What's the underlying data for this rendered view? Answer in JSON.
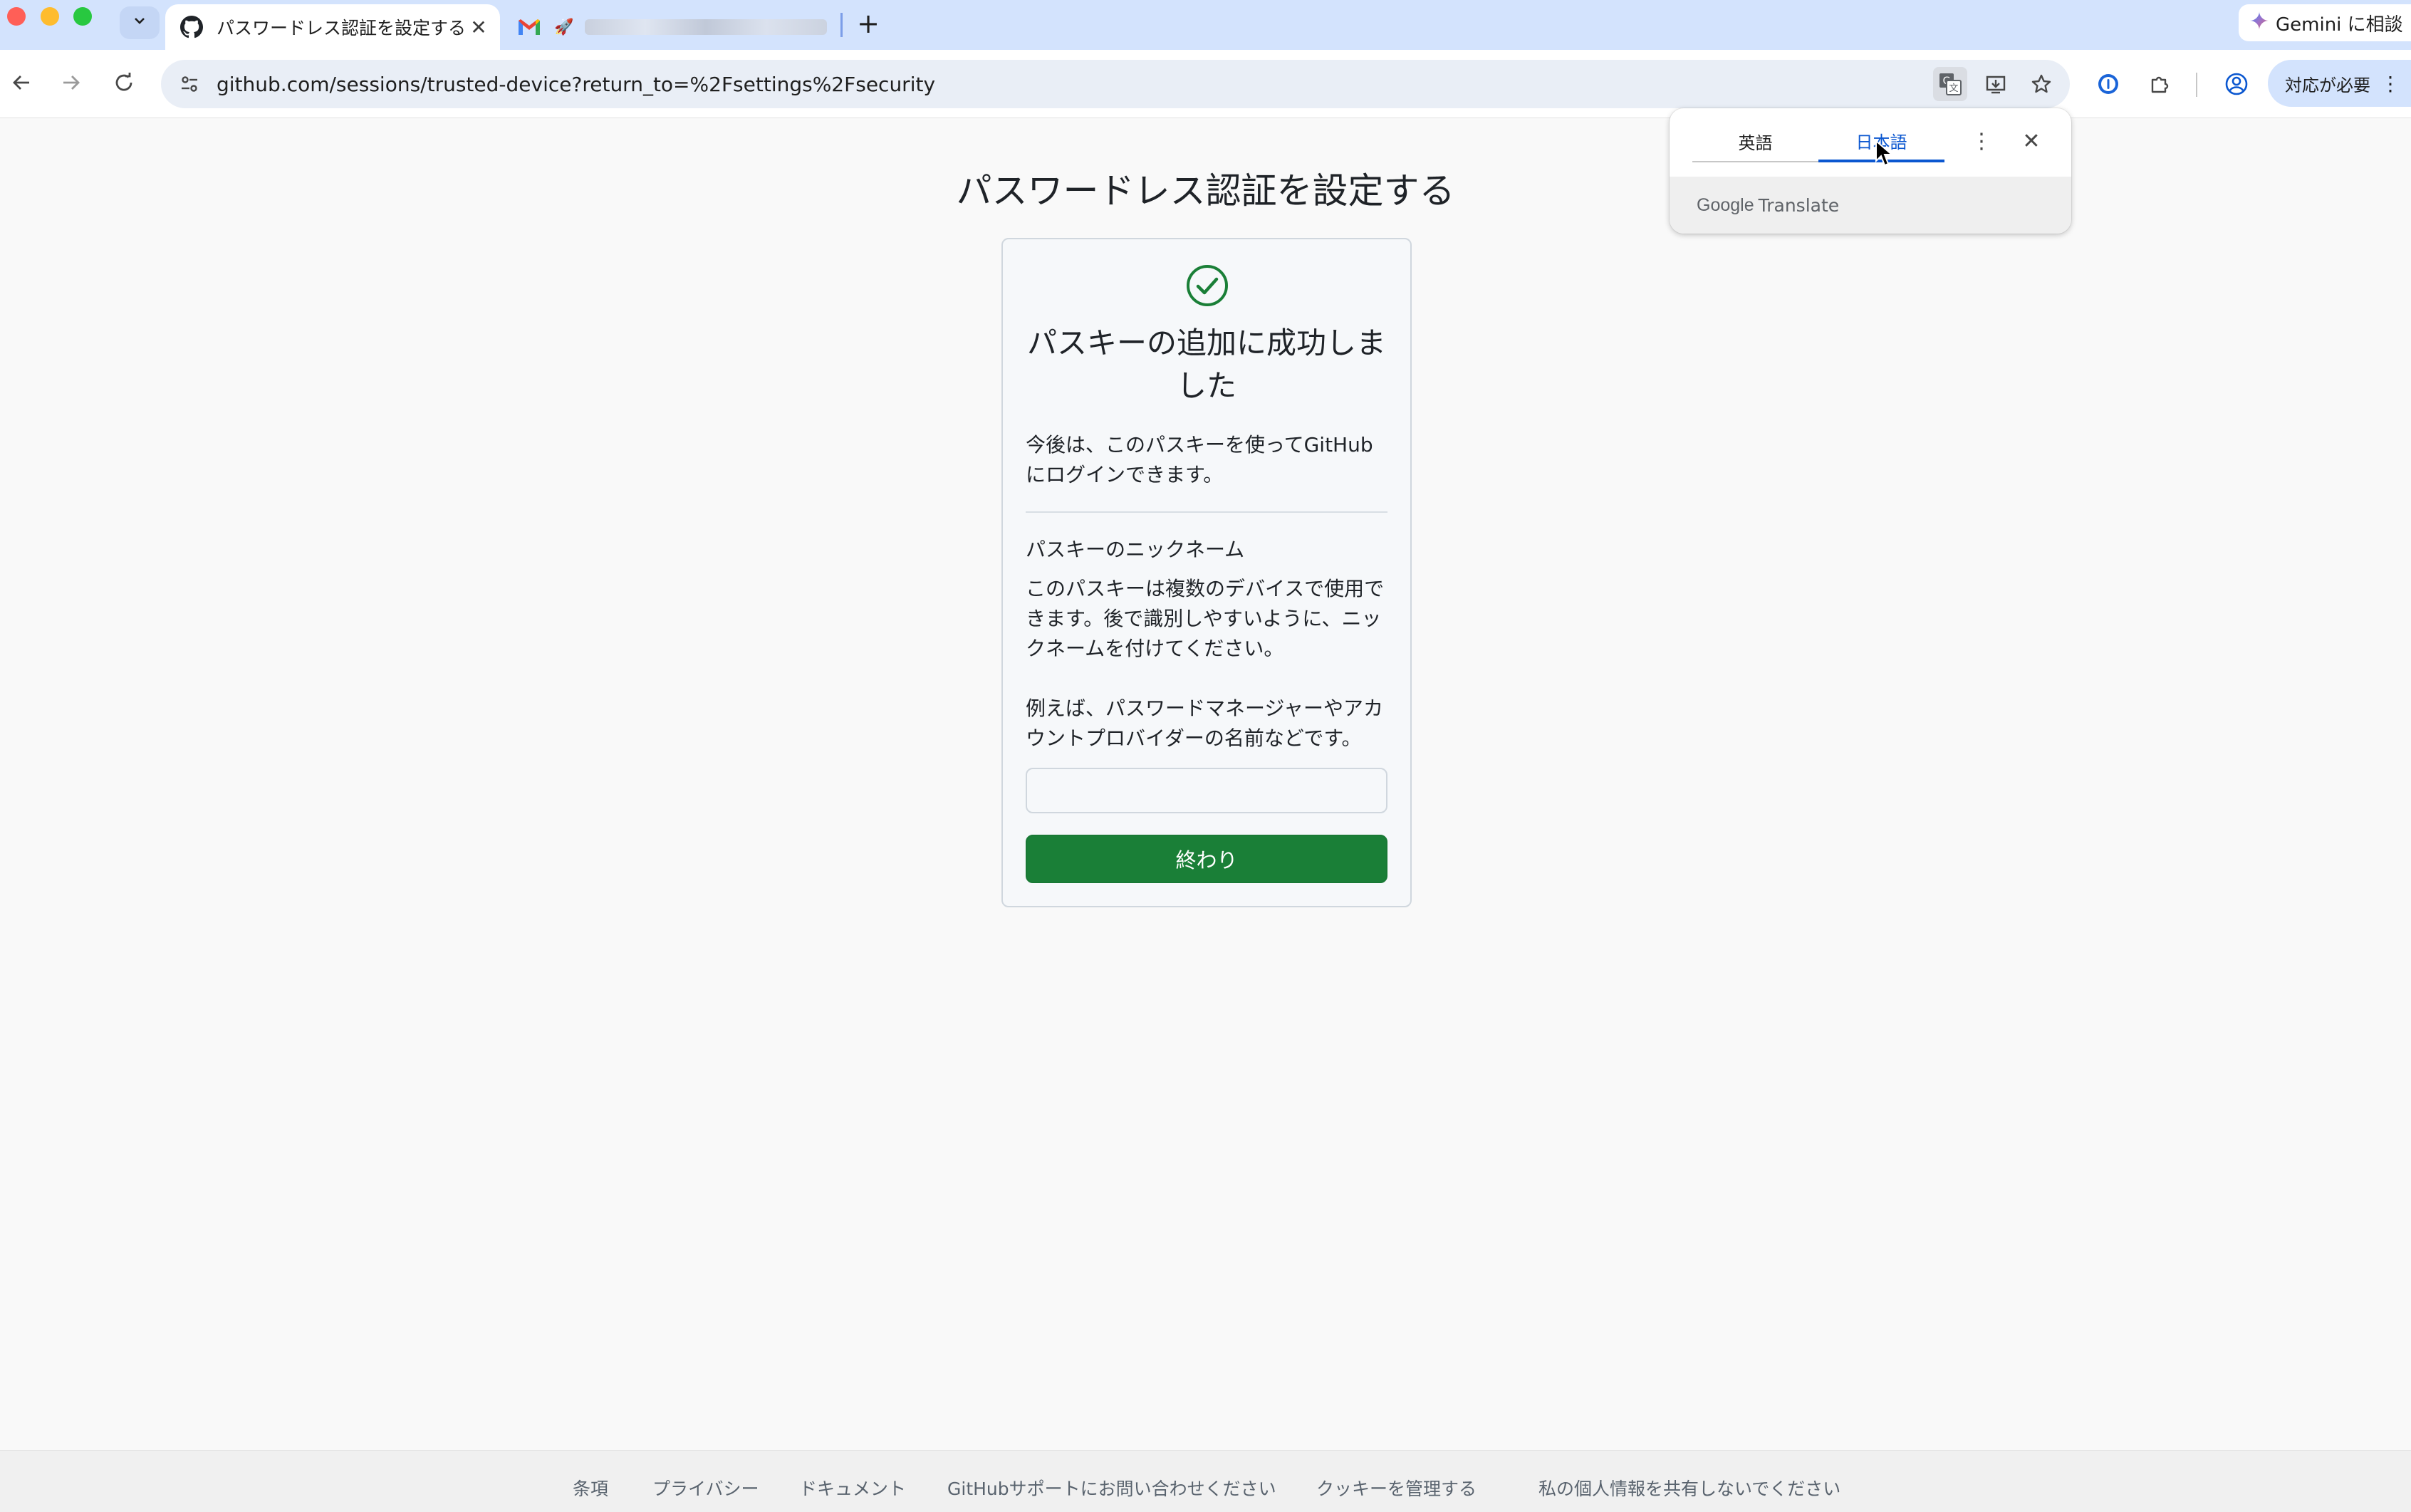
{
  "browser": {
    "tabs": [
      {
        "title": "パスワードレス認証を設定する",
        "icon": "github-icon",
        "active": true
      },
      {
        "title": "",
        "icon": "gmail-icon",
        "active": false
      }
    ],
    "new_tab_label": "+",
    "gemini_label": "Gemini に相談",
    "url": "github.com/sessions/trusted-device?return_to=%2Fsettings%2Fsecurity",
    "update_label": "対応が必要"
  },
  "translate": {
    "source_lang": "英語",
    "target_lang": "日本語",
    "brand_google": "Google",
    "brand_translate": "Translate"
  },
  "page": {
    "title": "パスワードレス認証を設定する",
    "card": {
      "heading": "パスキーの追加に成功しました",
      "description": "今後は、このパスキーを使ってGitHubにログインできます。",
      "nickname_label": "パスキーのニックネーム",
      "nickname_help": "このパスキーは複数のデバイスで使用できます。後で識別しやすいように、ニックネームを付けてください。",
      "nickname_example": "例えば、パスワードマネージャーやアカウントプロバイダーの名前などです。",
      "nickname_value": "",
      "done_label": "終わり"
    }
  },
  "footer": {
    "links": [
      "条項",
      "プライバシー",
      "ドキュメント",
      "GitHubサポートにお問い合わせください",
      "クッキーを管理する",
      "私の個人情報を共有しないでください"
    ]
  },
  "colors": {
    "accent_green": "#1a7f37",
    "chrome_blue": "#d3e3fd",
    "translate_blue": "#0b57d0"
  }
}
